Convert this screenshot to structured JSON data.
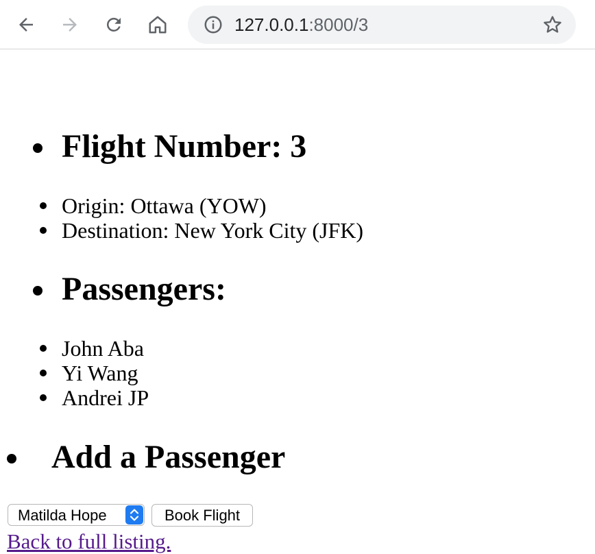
{
  "browser": {
    "url_host": "127.0.0.1",
    "url_path": ":8000/3"
  },
  "page": {
    "flight_heading": "Flight Number: 3",
    "origin": "Origin: Ottawa (YOW)",
    "destination": "Destination: New York City (JFK)",
    "passengers_heading": "Passengers:",
    "passengers": [
      "John Aba",
      "Yi Wang",
      "Andrei JP"
    ],
    "add_heading": "Add a Passenger",
    "select_value": "Matilda Hope",
    "book_button": "Book Flight",
    "back_link": "Back to full listing."
  },
  "colors": {
    "link_visited": "#551a8b",
    "select_accent": "#1f7bf0",
    "omnibox_bg": "#f1f3f4"
  },
  "icons": [
    "back-arrow-icon",
    "forward-arrow-icon",
    "reload-icon",
    "home-icon",
    "info-icon",
    "star-icon",
    "select-chevron-icon"
  ]
}
